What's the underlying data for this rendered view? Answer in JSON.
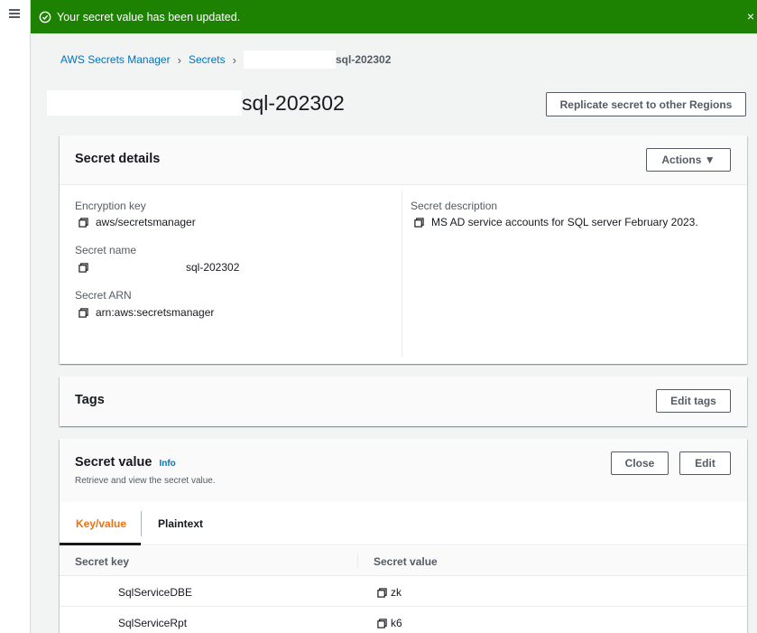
{
  "flash": {
    "message": "Your secret value has been updated.",
    "close_symbol": "×",
    "color": "#1d8102"
  },
  "breadcrumb": {
    "root": "AWS Secrets Manager",
    "secrets": "Secrets",
    "separator": "›",
    "current": "sql-202302"
  },
  "page": {
    "title": "sql-202302",
    "replicate_label": "Replicate secret to other Regions"
  },
  "details": {
    "title": "Secret details",
    "actions_label": "Actions ▼",
    "encryption_key_label": "Encryption key",
    "encryption_key_value": "aws/secretsmanager",
    "secret_name_label": "Secret name",
    "secret_name_value": "sql-202302",
    "secret_arn_label": "Secret ARN",
    "secret_arn_value": "arn:aws:secretsmanager",
    "description_label": "Secret description",
    "description_value": "MS AD service accounts for SQL server February 2023."
  },
  "tags": {
    "title": "Tags",
    "edit_label": "Edit tags"
  },
  "secret_value": {
    "title": "Secret value",
    "info_label": "Info",
    "subtitle": "Retrieve and view the secret value.",
    "close_label": "Close",
    "edit_label": "Edit",
    "tabs": [
      {
        "label": "Key/value"
      },
      {
        "label": "Plaintext"
      }
    ],
    "columns": {
      "key": "Secret key",
      "value": "Secret value"
    },
    "rows": [
      {
        "key": "SqlServiceDBE",
        "value": "zk"
      },
      {
        "key": "SqlServiceRpt",
        "value": "k6"
      }
    ]
  },
  "colors": {
    "link": "#0073bb",
    "active_tab": "#ec7211"
  }
}
